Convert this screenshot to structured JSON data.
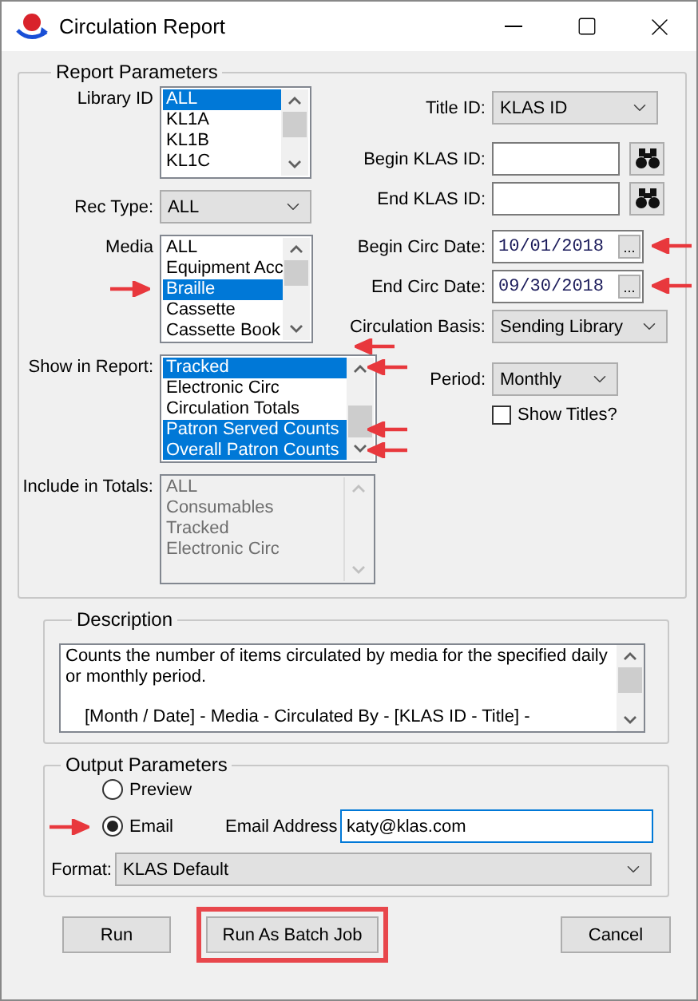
{
  "window": {
    "title": "Circulation Report"
  },
  "report_parameters": {
    "title": "Report Parameters",
    "library_id": {
      "label": "Library ID",
      "items": [
        {
          "text": "ALL",
          "selected": true
        },
        {
          "text": "KL1A",
          "selected": false
        },
        {
          "text": "KL1B",
          "selected": false
        },
        {
          "text": "KL1C",
          "selected": false
        }
      ]
    },
    "rec_type": {
      "label": "Rec Type:",
      "value": "ALL"
    },
    "media": {
      "label": "Media",
      "items": [
        {
          "text": "ALL",
          "selected": false,
          "arrow": false
        },
        {
          "text": "Equipment Acc",
          "selected": false,
          "arrow": false
        },
        {
          "text": "Braille",
          "selected": true,
          "arrow": true
        },
        {
          "text": "Cassette",
          "selected": false,
          "arrow": false
        },
        {
          "text": "Cassette Book",
          "selected": false,
          "arrow": false
        }
      ]
    },
    "show_in_report": {
      "label": "Show in Report:",
      "arrow": true,
      "items": [
        {
          "text": "Tracked",
          "selected": true,
          "arrow": true
        },
        {
          "text": "Electronic Circ",
          "selected": false,
          "arrow": false
        },
        {
          "text": "Circulation Totals",
          "selected": false,
          "arrow": false
        },
        {
          "text": "Patron Served Counts",
          "selected": true,
          "arrow": true
        },
        {
          "text": "Overall Patron Counts",
          "selected": true,
          "arrow": true
        }
      ]
    },
    "include_in_totals": {
      "label": "Include in Totals:",
      "disabled": true,
      "items": [
        {
          "text": "ALL",
          "selected": false
        },
        {
          "text": "Consumables",
          "selected": false
        },
        {
          "text": "Tracked",
          "selected": false
        },
        {
          "text": "Electronic Circ",
          "selected": false
        }
      ]
    },
    "title_id": {
      "label": "Title ID:",
      "value": "KLAS ID"
    },
    "begin_klas_id": {
      "label": "Begin KLAS ID:"
    },
    "end_klas_id": {
      "label": "End KLAS ID:"
    },
    "begin_circ_date": {
      "label": "Begin Circ Date:",
      "value": "10/01/2018",
      "button": "...",
      "arrow": true
    },
    "end_circ_date": {
      "label": "End Circ Date:",
      "value": "09/30/2018",
      "button": "...",
      "arrow": true
    },
    "circulation_basis": {
      "label": "Circulation Basis:",
      "value": "Sending Library"
    },
    "period": {
      "label": "Period:",
      "value": "Monthly"
    },
    "show_titles": {
      "label": "Show Titles?",
      "checked": false
    }
  },
  "description": {
    "title": "Description",
    "paragraphs": [
      "Counts the number of items circulated by media for the specified daily or monthly period.",
      "[Month / Date] - Media - Circulated By - [KLAS ID - Title] -"
    ]
  },
  "output_parameters": {
    "title": "Output Parameters",
    "options": [
      {
        "label": "Preview",
        "selected": false,
        "arrow": false
      },
      {
        "label": "Email",
        "selected": true,
        "arrow": true
      }
    ],
    "email_address": {
      "label": "Email Address",
      "value": "katy@klas.com"
    },
    "format": {
      "label": "Format:",
      "value": "KLAS Default"
    }
  },
  "buttons": [
    {
      "label": "Run",
      "highlighted": false
    },
    {
      "label": "Run As Batch Job",
      "highlighted": true
    },
    {
      "label": "Cancel",
      "highlighted": false
    }
  ]
}
